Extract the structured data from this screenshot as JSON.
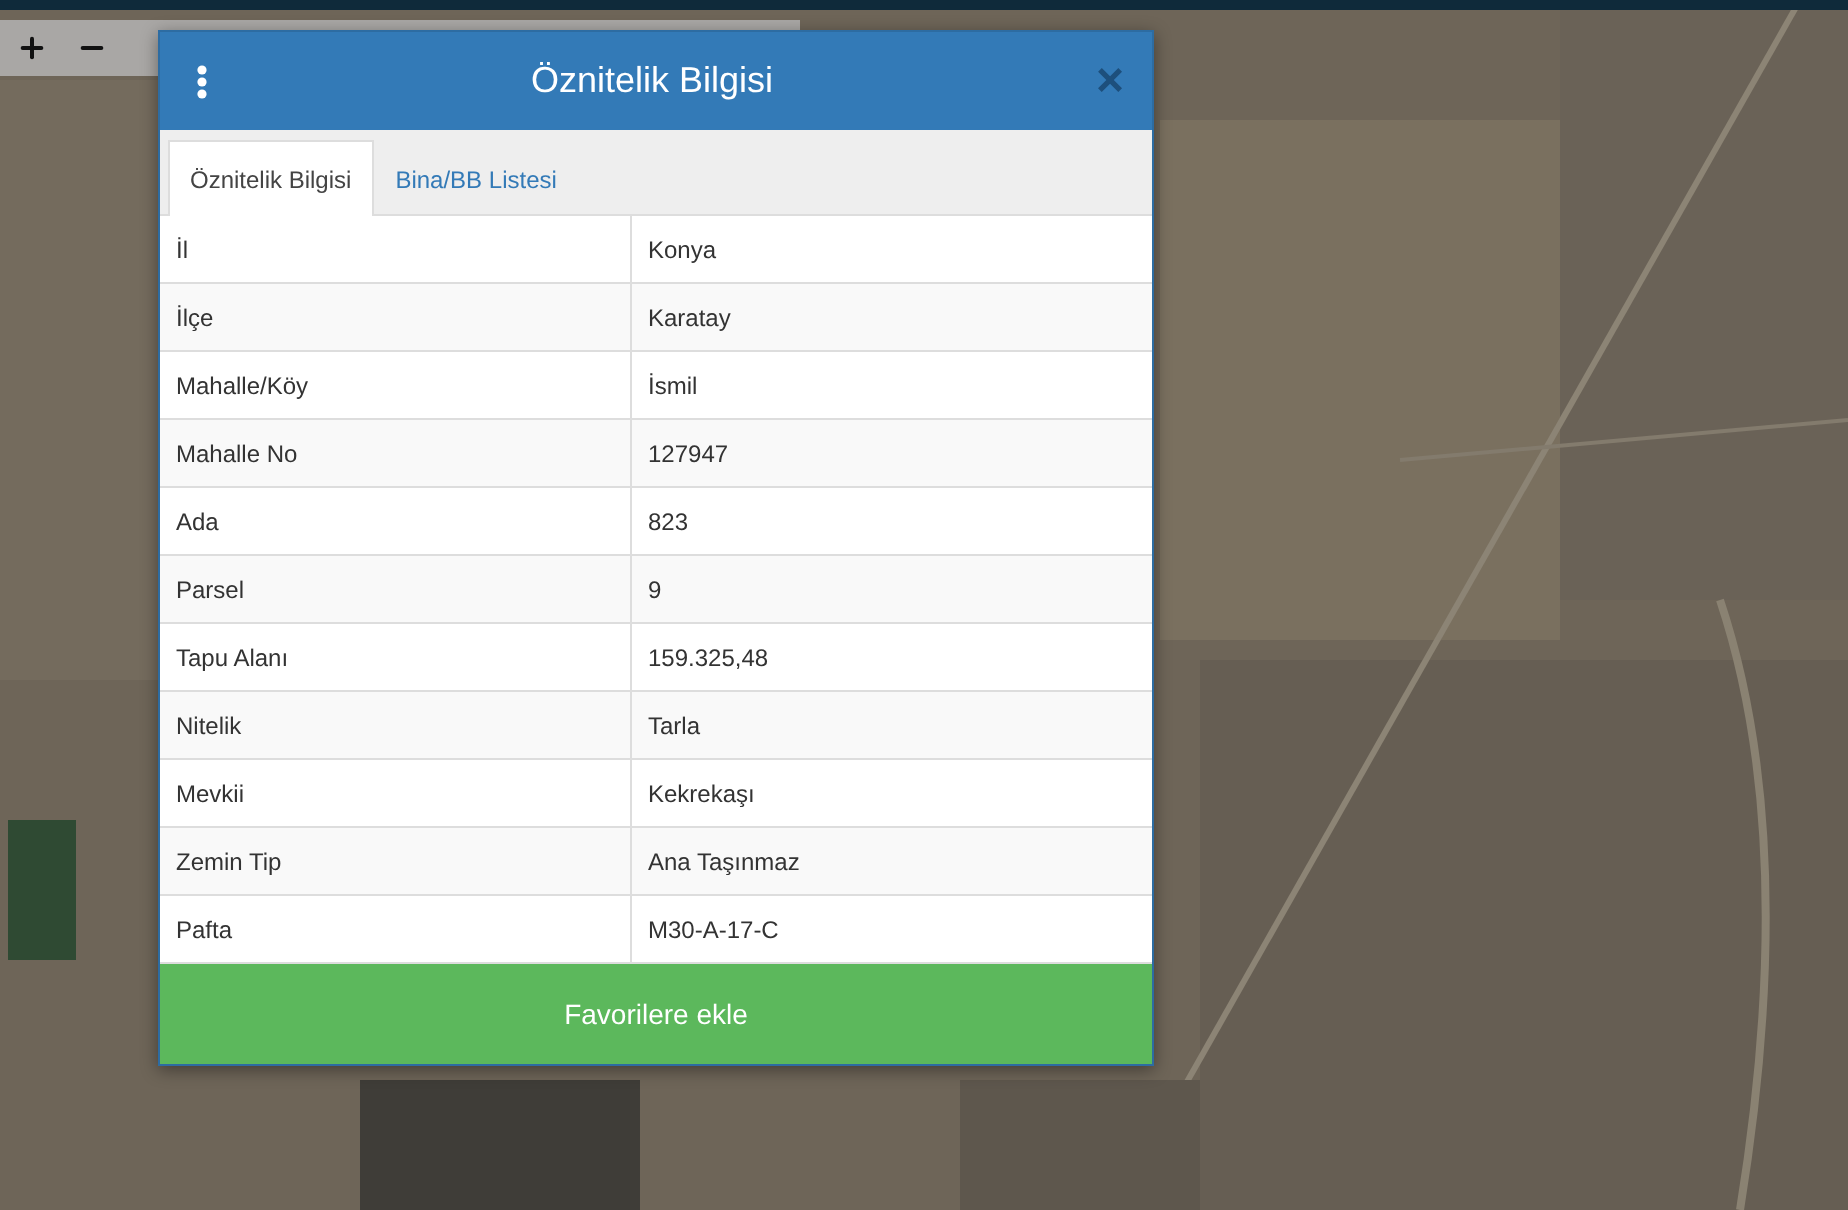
{
  "dialog": {
    "title": "Öznitelik Bilgisi",
    "close": "×"
  },
  "tabs": [
    {
      "label": "Öznitelik Bilgisi",
      "selected": true
    },
    {
      "label": "Bina/BB Listesi",
      "selected": false
    }
  ],
  "rows": [
    {
      "label": "İl",
      "value": "Konya"
    },
    {
      "label": "İlçe",
      "value": "Karatay"
    },
    {
      "label": "Mahalle/Köy",
      "value": "İsmil"
    },
    {
      "label": "Mahalle No",
      "value": "127947"
    },
    {
      "label": "Ada",
      "value": "823"
    },
    {
      "label": "Parsel",
      "value": "9"
    },
    {
      "label": "Tapu Alanı",
      "value": "159.325,48"
    },
    {
      "label": "Nitelik",
      "value": "Tarla"
    },
    {
      "label": "Mevkii",
      "value": "Kekrekaşı"
    },
    {
      "label": "Zemin Tip",
      "value": "Ana Taşınmaz"
    },
    {
      "label": "Pafta",
      "value": "M30-A-17-C"
    }
  ],
  "action_button": "Favorilere ekle"
}
